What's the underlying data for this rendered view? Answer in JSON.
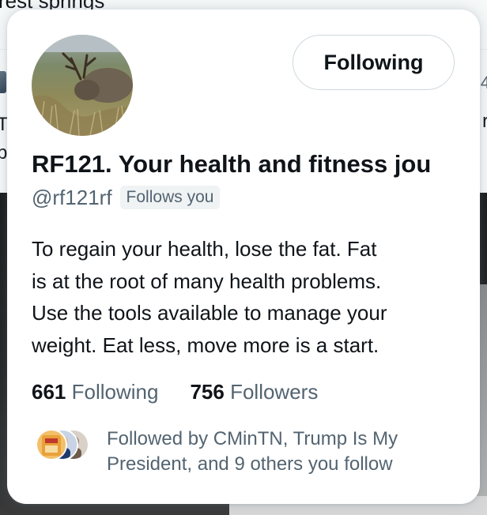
{
  "background": {
    "top_text": "rest springs",
    "left_snippet_line1": "T",
    "left_snippet_line2": "b",
    "right_snippet_top": "4",
    "right_snippet_mid": "r"
  },
  "profile_card": {
    "display_name": "RF121. Your health and fitness jou",
    "handle": "@rf121rf",
    "follows_you_label": "Follows you",
    "follow_button_label": "Following",
    "bio_lines": [
      "To regain your health, lose the fat. Fat",
      "is at the root of many health problems.",
      "Use the tools available to manage your",
      "weight. Eat less, move more is a start."
    ],
    "stats": {
      "following_count": "661",
      "following_label": "Following",
      "followers_count": "756",
      "followers_label": "Followers"
    },
    "followed_by": {
      "line1": "Followed by CMinTN, Trump Is My",
      "line2": "President, and 9 others you follow"
    }
  },
  "colors": {
    "text_primary": "#0f1419",
    "text_secondary": "#536471",
    "border": "#cfd9de",
    "badge_bg": "#eff3f4"
  },
  "icons": {
    "avatar": "deer-photo-avatar",
    "mini_avatars": [
      "cminTN-avatar",
      "trump-is-my-president-avatar",
      "follower-avatar"
    ]
  }
}
